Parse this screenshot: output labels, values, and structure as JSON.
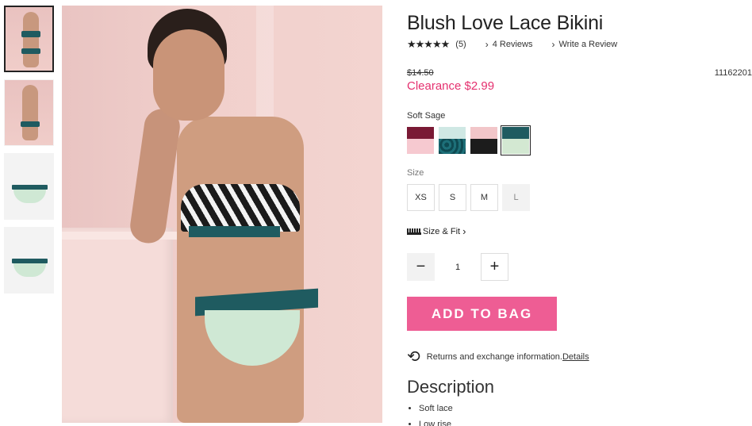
{
  "product": {
    "title": "Blush Love Lace Bikini",
    "stars": "★★★★★",
    "review_count": "(5)",
    "reviews_link": "4 Reviews",
    "write_review": "Write a Review",
    "old_price": "$14.50",
    "sku": "11162201",
    "clearance": "Clearance $2.99"
  },
  "color": {
    "selected_label": "Soft Sage",
    "swatches": [
      {
        "name": "burgundy-pink",
        "top": "#7a1a35",
        "bottom": "#f6c9d0"
      },
      {
        "name": "teal-leopard",
        "top": "#cfe8e4",
        "bottom": "#0e4a52"
      },
      {
        "name": "pink-black-star",
        "top": "#f2c6c9",
        "bottom": "#1c1c1c"
      },
      {
        "name": "soft-sage",
        "top": "#1f5b60",
        "bottom": "#d3e8d2"
      }
    ]
  },
  "size": {
    "label": "Size",
    "options": [
      "XS",
      "S",
      "M",
      "L"
    ]
  },
  "size_fit": "Size & Fit",
  "quantity": {
    "minus": "−",
    "value": "1",
    "plus": "+"
  },
  "add_to_bag": "ADD TO BAG",
  "returns": {
    "text": "Returns and exchange information.",
    "link": "Details"
  },
  "description": {
    "title": "Description",
    "items": [
      "Soft lace",
      "Low rise"
    ]
  },
  "colors": {
    "accent": "#ee5d94",
    "clearance": "#e5306f"
  }
}
